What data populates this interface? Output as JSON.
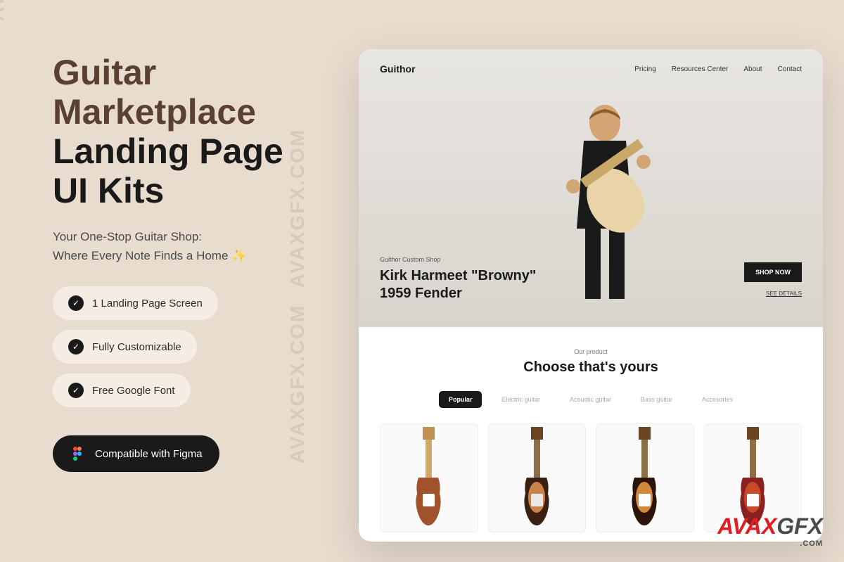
{
  "watermark": "AVAXGFX.COM",
  "left": {
    "title_line1": "Guitar",
    "title_line2": "Marketplace",
    "title_line3": "Landing Page",
    "title_line4": "UI Kits",
    "subtitle_line1": "Your One-Stop Guitar Shop:",
    "subtitle_line2": "Where Every Note Finds a Home ✨",
    "features": [
      "1 Landing Page Screen",
      "Fully Customizable",
      "Free Google Font"
    ],
    "figma_label": "Compatible with Figma"
  },
  "preview": {
    "logo": "Guithor",
    "nav": [
      "Pricing",
      "Resources Center",
      "About",
      "Contact"
    ],
    "hero": {
      "eyebrow": "Guithor Custom Shop",
      "title_line1": "Kirk Harmeet \"Browny\"",
      "title_line2": "1959 Fender",
      "shop_btn": "SHOP NOW",
      "see_details": "SEE DETAILS"
    },
    "products": {
      "eyebrow": "Our product",
      "title": "Choose that's yours",
      "tabs": [
        "Popular",
        "Electric guitar",
        "Acoustic guitar",
        "Bass guitar",
        "Accesories"
      ],
      "items": [
        "guitar-1",
        "guitar-2",
        "guitar-3",
        "guitar-4"
      ]
    }
  },
  "brand": {
    "red": "AVAX",
    "gray": "GFX",
    "com": ".COM"
  }
}
